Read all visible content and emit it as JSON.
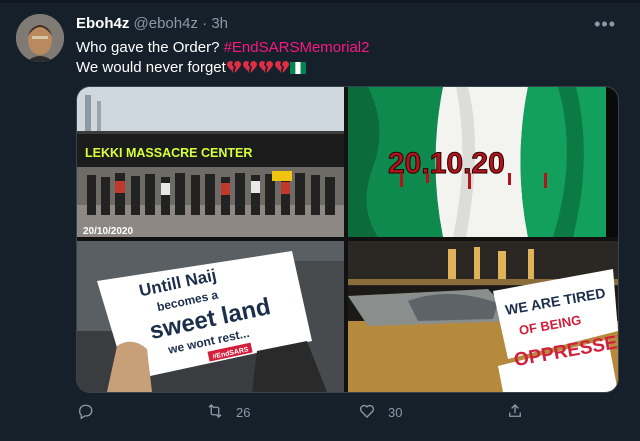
{
  "tweet": {
    "display_name": "Eboh4z",
    "handle": "@eboh4z",
    "separator": "·",
    "time": "3h",
    "more_label": "•••",
    "line1_text": "Who gave the Order? ",
    "hashtag": "#EndSARSMemorial2",
    "line2_text": "We would never forget",
    "emojis": [
      "broken-heart-icon",
      "broken-heart-icon",
      "broken-heart-icon",
      "broken-heart-icon",
      "nigeria-flag-icon"
    ]
  },
  "media": {
    "image1": {
      "sign_text": "LEKKI MASSACRE CENTER",
      "date_text": "20/10/2020"
    },
    "image2": {
      "flag_text": "20.10.20"
    },
    "image3": {
      "line1": "Untill Naij",
      "line2": "becomes a",
      "line3": "sweet land",
      "line4": "we wont rest...",
      "tag": "#EndSARS"
    },
    "image4": {
      "line1": "WE ARE TIRED",
      "line2": "OF BEING",
      "line3": "OPPRESSED"
    }
  },
  "actions": {
    "reply_count": "",
    "retweet_count": "26",
    "like_count": "30"
  },
  "colors": {
    "background": "#15202b",
    "hashtag": "#f91880",
    "muted": "#8b98a5",
    "nigeria_green": "#008751"
  }
}
